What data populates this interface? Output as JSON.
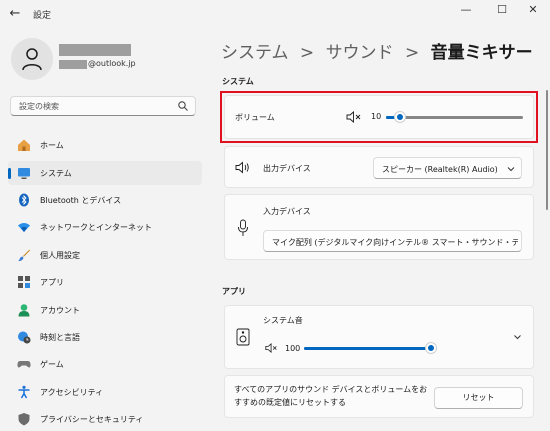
{
  "window": {
    "title": "設定",
    "back_glyph": "←",
    "min_glyph": "—",
    "max_glyph": "☐",
    "close_glyph": "✕"
  },
  "profile": {
    "email_suffix": "@outlook.jp"
  },
  "search": {
    "placeholder": "設定の検索"
  },
  "nav": {
    "items": [
      {
        "label": "ホーム",
        "icon": "home-icon"
      },
      {
        "label": "システム",
        "icon": "monitor-icon",
        "selected": true
      },
      {
        "label": "Bluetooth とデバイス",
        "icon": "bluetooth-icon"
      },
      {
        "label": "ネットワークとインターネット",
        "icon": "wifi-icon"
      },
      {
        "label": "個人用設定",
        "icon": "brush-icon"
      },
      {
        "label": "アプリ",
        "icon": "apps-icon"
      },
      {
        "label": "アカウント",
        "icon": "person-icon"
      },
      {
        "label": "時刻と言語",
        "icon": "globe-clock-icon"
      },
      {
        "label": "ゲーム",
        "icon": "gamepad-icon"
      },
      {
        "label": "アクセシビリティ",
        "icon": "accessibility-icon"
      },
      {
        "label": "プライバシーとセキュリティ",
        "icon": "shield-icon"
      }
    ]
  },
  "breadcrumb": {
    "part1": "システム",
    "sep": ">",
    "part2": "サウンド",
    "current": "音量ミキサー"
  },
  "system_section": {
    "heading": "システム",
    "volume": {
      "label": "ボリューム",
      "value": "10",
      "level": 0.1
    },
    "output": {
      "label": "出力デバイス",
      "selected": "スピーカー (Realtek(R) Audio)"
    },
    "input": {
      "label": "入力デバイス",
      "selected": "マイク配列 (デジタルマイク向けインテル® スマート・サウンド・テクノロジー)"
    }
  },
  "apps_section": {
    "heading": "アプリ",
    "system_sounds": {
      "label": "システム音",
      "value": "100",
      "level": 1.0
    },
    "reset": {
      "text": "すべてのアプリのサウンド デバイスとボリュームをおすすめの既定値にリセットする",
      "button": "リセット"
    }
  },
  "colors": {
    "accent": "#0067c0",
    "highlight": "#e0101e"
  }
}
